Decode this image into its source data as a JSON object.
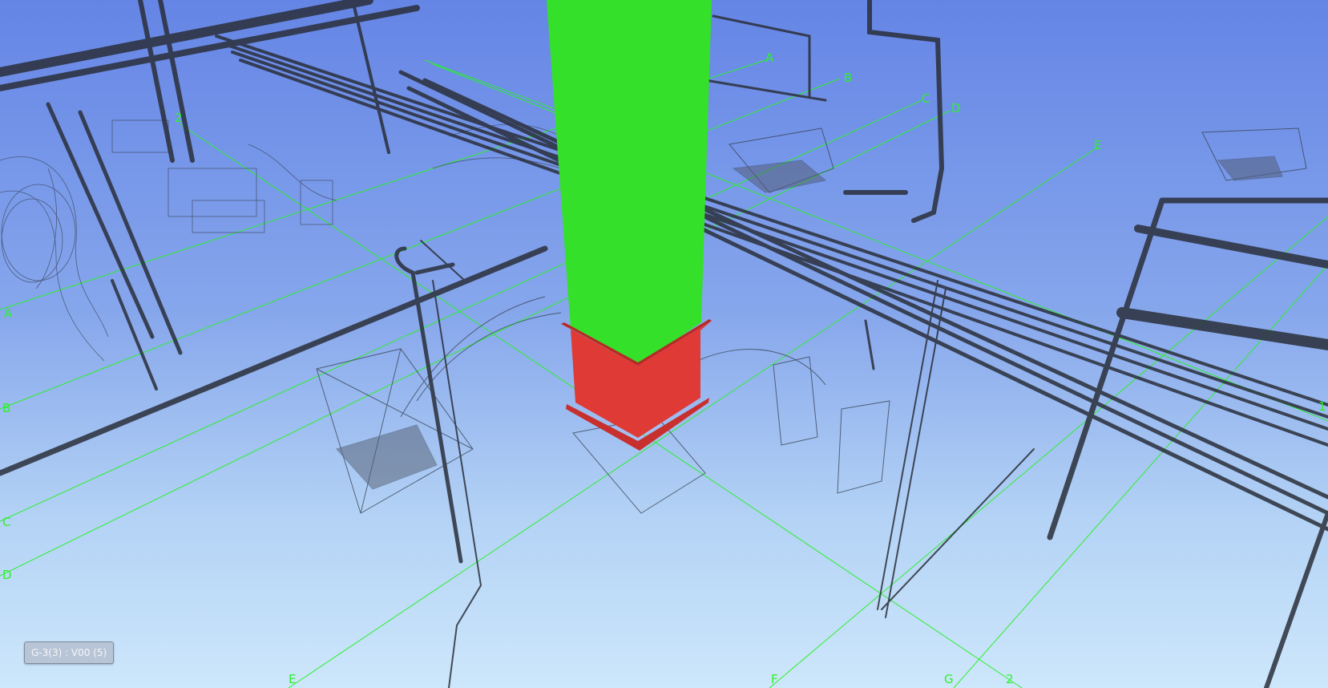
{
  "viewer": {
    "view_name": "G-3(3) : V00 (5)"
  },
  "grid_labels": [
    "A",
    "B",
    "C",
    "D",
    "E",
    "F",
    "G",
    "2",
    "2",
    "A",
    "B",
    "C",
    "D",
    "E",
    "1"
  ],
  "colors": {
    "grid_line": "#2cf02c",
    "selected_column_shaft": "#34e02a",
    "selected_column_base": "#e03a37",
    "pipe_wire": "#2a2f3a",
    "duct_wire": "#36404f"
  }
}
